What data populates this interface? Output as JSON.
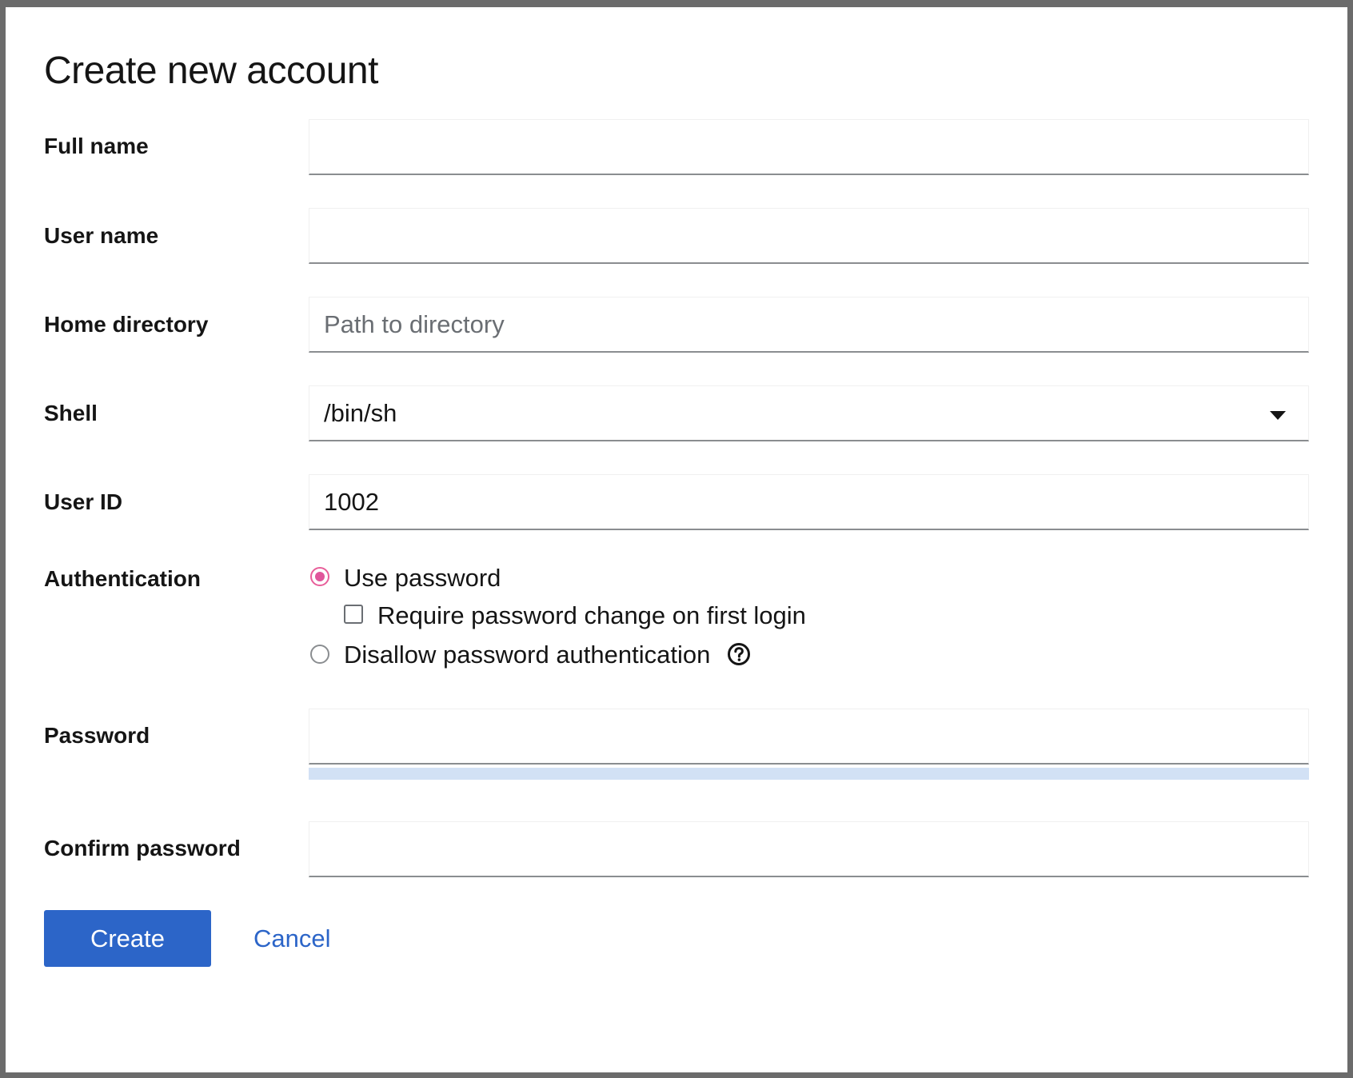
{
  "dialog": {
    "title": "Create new account"
  },
  "form": {
    "full_name": {
      "label": "Full name",
      "value": "",
      "placeholder": ""
    },
    "user_name": {
      "label": "User name",
      "value": "",
      "placeholder": ""
    },
    "home_directory": {
      "label": "Home directory",
      "value": "",
      "placeholder": "Path to directory"
    },
    "shell": {
      "label": "Shell",
      "selected": "/bin/sh"
    },
    "user_id": {
      "label": "User ID",
      "value": "1002"
    },
    "authentication": {
      "label": "Authentication",
      "options": [
        {
          "label": "Use password",
          "checked": true
        },
        {
          "label": "Disallow password authentication",
          "checked": false
        }
      ],
      "require_change_label": "Require password change on first login",
      "require_change_checked": false,
      "help_icon": "question-circle-icon"
    },
    "password": {
      "label": "Password",
      "value": ""
    },
    "confirm_password": {
      "label": "Confirm password",
      "value": ""
    }
  },
  "actions": {
    "create_label": "Create",
    "cancel_label": "Cancel"
  },
  "colors": {
    "primary": "#2c65c8",
    "radio_selected": "#e0569b",
    "strength_bar": "#d2e1f5"
  }
}
